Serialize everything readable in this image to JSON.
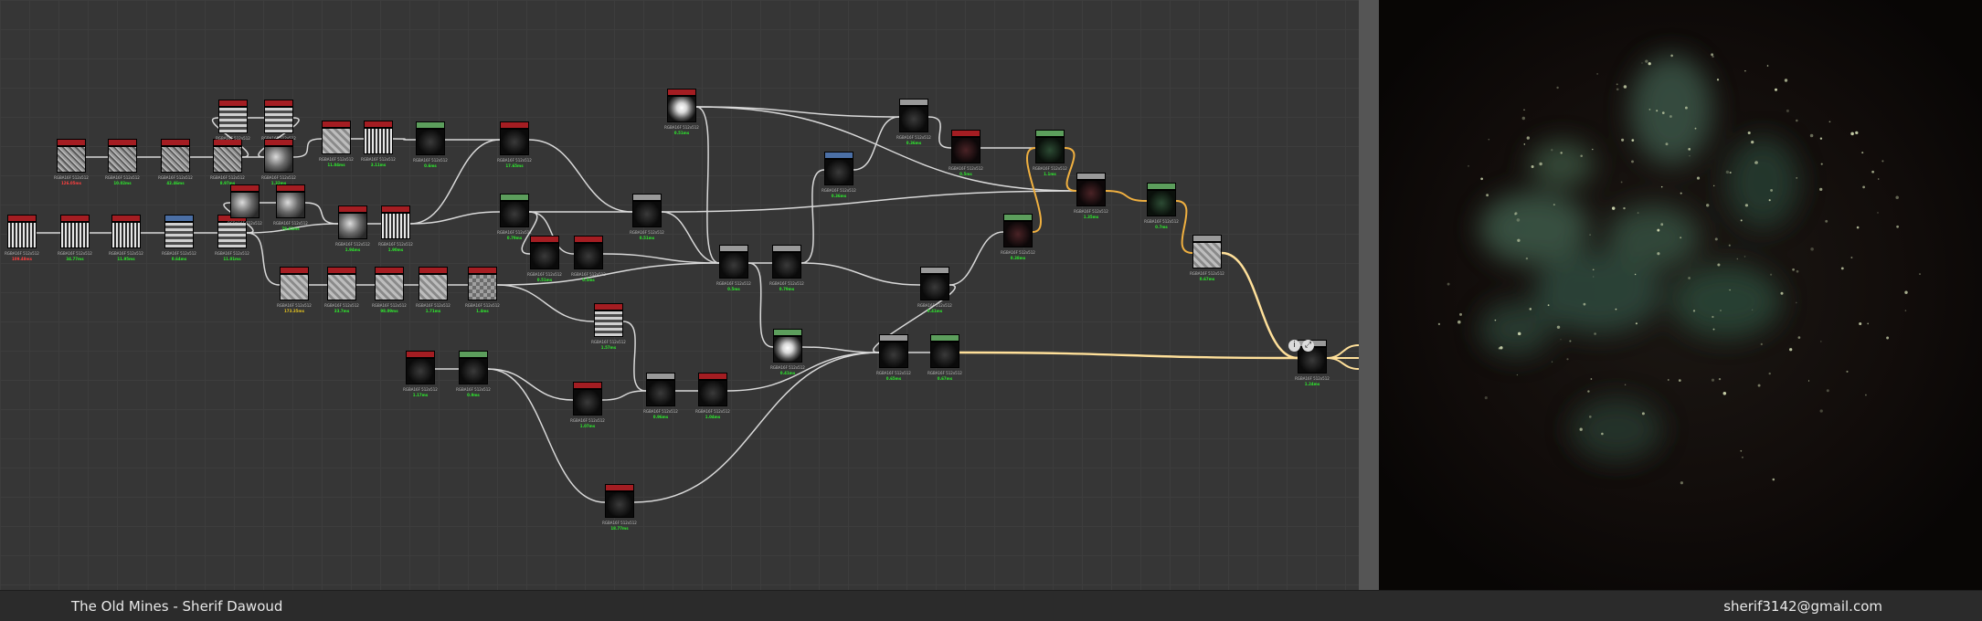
{
  "status_bar": {
    "title": "The Old Mines - Sherif Dawoud",
    "email": "sherif3142@gmail.com"
  },
  "icons": {
    "output_badge_left": "info-icon",
    "output_badge_right": "expand-icon"
  },
  "colors": {
    "header_red": "#a41d22",
    "header_green": "#5c9e5c",
    "header_grey": "#9a9a9a",
    "header_blue": "#4b6fa5",
    "wire_default": "#d9d9d9",
    "wire_selected": "#f0b040",
    "wire_output": "#ffe09a",
    "time_green": "#2ee82e",
    "time_red": "#ff4040"
  },
  "nodes": [
    {
      "id": "n1",
      "header": "red",
      "thumb": "t-noise",
      "res": "RGBA16F 512x512",
      "time": "126.05ms",
      "time_class": "hot"
    },
    {
      "id": "n2",
      "header": "red",
      "thumb": "t-noise",
      "res": "RGBA16F 512x512",
      "time": "10.02ms"
    },
    {
      "id": "n3",
      "header": "red",
      "thumb": "t-noise",
      "res": "RGBA16F 512x512",
      "time": "42.46ms"
    },
    {
      "id": "n4",
      "header": "red",
      "thumb": "t-noise",
      "res": "RGBA16F 512x512",
      "time": "8.97ms"
    },
    {
      "id": "n5",
      "header": "red",
      "thumb": "t-wave",
      "res": "RGBA16F 512x512",
      "time": "",
      "time_class": ""
    },
    {
      "id": "n6",
      "header": "red",
      "thumb": "t-wave",
      "res": "RGBA16F 512x512",
      "time": "",
      "time_class": ""
    },
    {
      "id": "n7",
      "header": "red",
      "thumb": "t-blob",
      "res": "RGBA16F 512x512",
      "time": "1.32ms"
    },
    {
      "id": "n8",
      "header": "red",
      "thumb": "t-light",
      "res": "RGBA16F 512x512",
      "time": "11.04ms"
    },
    {
      "id": "n9",
      "header": "red",
      "thumb": "t-stripe",
      "res": "RGBA16F 512x512",
      "time": "3.11ms"
    },
    {
      "id": "n10",
      "header": "green",
      "thumb": "t-dark",
      "res": "RGBA16F 512x512",
      "time": "0.6ms"
    },
    {
      "id": "n11",
      "header": "red",
      "thumb": "t-dark",
      "res": "RGBA16F 512x512",
      "time": "17.65ms"
    },
    {
      "id": "n12",
      "header": "red",
      "thumb": "t-stripe",
      "res": "RGBA16F 512x512",
      "time": "109.48ms",
      "time_class": "hot"
    },
    {
      "id": "n13",
      "header": "red",
      "thumb": "t-stripe",
      "res": "RGBA16F 512x512",
      "time": "34.77ms"
    },
    {
      "id": "n14",
      "header": "red",
      "thumb": "t-stripe",
      "res": "RGBA16F 512x512",
      "time": "11.95ms"
    },
    {
      "id": "n15",
      "header": "blue",
      "thumb": "t-wave",
      "res": "RGBA16F 512x512",
      "time": "0.64ms"
    },
    {
      "id": "n16",
      "header": "red",
      "thumb": "t-wave",
      "res": "RGBA16F 512x512",
      "time": "11.01ms"
    },
    {
      "id": "n17",
      "header": "red",
      "thumb": "t-blob",
      "res": "RGBA16F 512x512",
      "time": ""
    },
    {
      "id": "n18",
      "header": "red",
      "thumb": "t-blob",
      "res": "RGBA16F 512x512",
      "time": "78.61ms"
    },
    {
      "id": "n19",
      "header": "red",
      "thumb": "t-blob",
      "res": "RGBA16F 512x512",
      "time": "1.94ms"
    },
    {
      "id": "n20",
      "header": "red",
      "thumb": "t-stripe",
      "res": "RGBA16F 512x512",
      "time": "1.90ms"
    },
    {
      "id": "n21",
      "header": "green",
      "thumb": "t-dark",
      "res": "RGBA16F 512x512",
      "time": "0.79ms"
    },
    {
      "id": "n22",
      "header": "red",
      "thumb": "t-dark",
      "res": "RGBA16F 512x512",
      "time": "0.51ms"
    },
    {
      "id": "n23",
      "header": "red",
      "thumb": "t-dark",
      "res": "RGBA16F 512x512",
      "time": "0.5ms"
    },
    {
      "id": "n24",
      "header": "grey",
      "thumb": "t-dark",
      "res": "RGBA16F 512x512",
      "time": "0.51ms"
    },
    {
      "id": "n25",
      "header": "red",
      "thumb": "t-light",
      "res": "RGBA16F 512x512",
      "time": "173.35ms",
      "time_class": "warm"
    },
    {
      "id": "n26",
      "header": "red",
      "thumb": "t-light",
      "res": "RGBA16F 512x512",
      "time": "33.7ms"
    },
    {
      "id": "n27",
      "header": "red",
      "thumb": "t-light",
      "res": "RGBA16F 512x512",
      "time": "98.09ms"
    },
    {
      "id": "n28",
      "header": "red",
      "thumb": "t-light",
      "res": "RGBA16F 512x512",
      "time": "1.71ms"
    },
    {
      "id": "n29",
      "header": "red",
      "thumb": "t-check",
      "res": "RGBA16F 512x512",
      "time": "1.4ms"
    },
    {
      "id": "n30",
      "header": "red",
      "thumb": "t-sphere",
      "res": "RGBA16F 512x512",
      "time": "0.51ms"
    },
    {
      "id": "n31",
      "header": "grey",
      "thumb": "t-dark",
      "res": "RGBA16F 512x512",
      "time": "0.5ms"
    },
    {
      "id": "n32",
      "header": "grey",
      "thumb": "t-dark",
      "res": "RGBA16F 512x512",
      "time": "0.79ms"
    },
    {
      "id": "n33",
      "header": "blue",
      "thumb": "t-dark",
      "res": "RGBA16F 512x512",
      "time": "0.36ms"
    },
    {
      "id": "n34",
      "header": "grey",
      "thumb": "t-dark",
      "res": "RGBA16F 512x512",
      "time": "0.36ms"
    },
    {
      "id": "n35",
      "header": "red",
      "thumb": "t-darkred",
      "res": "RGBA16F 512x512",
      "time": "0.5ms"
    },
    {
      "id": "n36",
      "header": "green",
      "thumb": "t-darkgreen",
      "res": "RGBA16F 512x512",
      "time": "1.1ms"
    },
    {
      "id": "n37",
      "header": "grey",
      "thumb": "t-darkred",
      "res": "RGBA16F 512x512",
      "time": "1.35ms"
    },
    {
      "id": "n38",
      "header": "green",
      "thumb": "t-darkgreen",
      "res": "RGBA16F 512x512",
      "time": "0.7ms"
    },
    {
      "id": "n39",
      "header": "green",
      "thumb": "t-darkred",
      "res": "RGBA16F 512x512",
      "time": "0.38ms"
    },
    {
      "id": "n40",
      "header": "grey",
      "thumb": "t-dark",
      "res": "RGBA16F 512x512",
      "time": "0.41ms"
    },
    {
      "id": "n41",
      "header": "grey",
      "thumb": "t-light",
      "res": "RGBA16F 512x512",
      "time": "0.67ms"
    },
    {
      "id": "n42",
      "header": "red",
      "thumb": "t-wave",
      "res": "RGBA16F 512x512",
      "time": "1.57ms"
    },
    {
      "id": "n43",
      "header": "green",
      "thumb": "t-sphere",
      "res": "RGBA16F 512x512",
      "time": "0.41ms"
    },
    {
      "id": "n44",
      "header": "red",
      "thumb": "t-dark",
      "res": "RGBA16F 512x512",
      "time": "1.17ms"
    },
    {
      "id": "n45",
      "header": "green",
      "thumb": "t-dark",
      "res": "RGBA16F 512x512",
      "time": "0.9ms"
    },
    {
      "id": "n46",
      "header": "red",
      "thumb": "t-dark",
      "res": "RGBA16F 512x512",
      "time": "1.07ms"
    },
    {
      "id": "n47",
      "header": "grey",
      "thumb": "t-dark",
      "res": "RGBA16F 512x512",
      "time": "0.96ms"
    },
    {
      "id": "n48",
      "header": "red",
      "thumb": "t-dark",
      "res": "RGBA16F 512x512",
      "time": "1.04ms"
    },
    {
      "id": "n49",
      "header": "grey",
      "thumb": "t-dark",
      "res": "RGBA16F 512x512",
      "time": "0.65ms"
    },
    {
      "id": "n50",
      "header": "green",
      "thumb": "t-dark",
      "res": "RGBA16F 512x512",
      "time": "0.67ms"
    },
    {
      "id": "n51",
      "header": "red",
      "thumb": "t-dark",
      "res": "RGBA16F 512x512",
      "time": "18.77ms"
    },
    {
      "id": "n52",
      "header": "grey",
      "thumb": "t-dark",
      "res": "RGBA16F 512x512",
      "time": "1.24ms"
    }
  ]
}
